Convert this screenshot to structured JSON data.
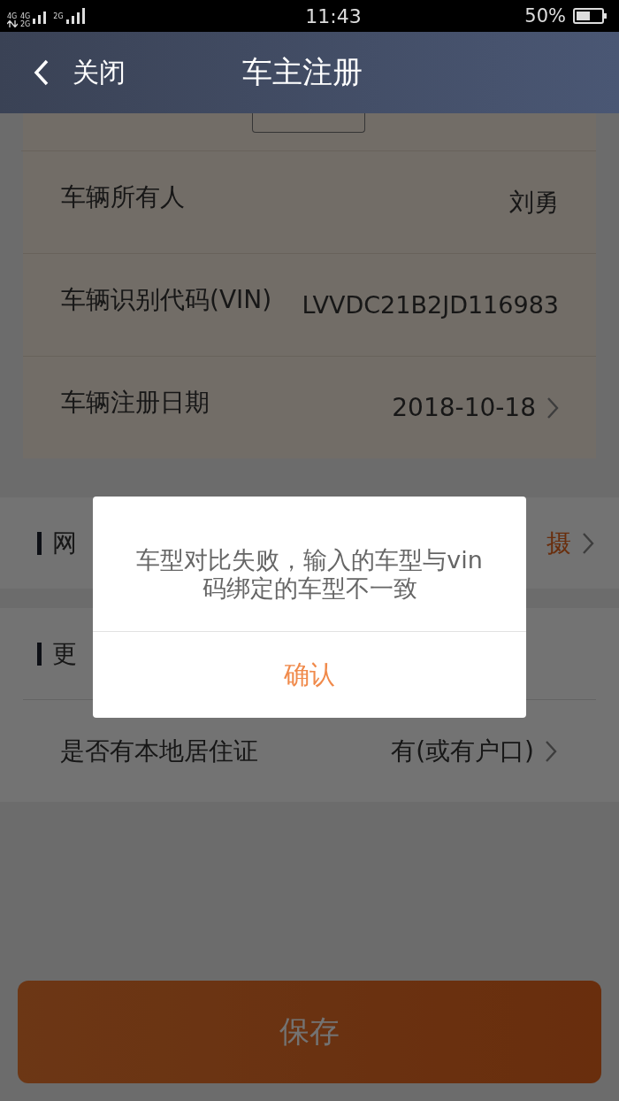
{
  "status_bar": {
    "network_labels": [
      "4G",
      "4G",
      "2G",
      "2G"
    ],
    "time": "11:43",
    "battery": "50%"
  },
  "nav": {
    "back_label": "关闭",
    "title": "车主注册"
  },
  "vehicle_rows": [
    {
      "label": "车辆所有人",
      "value": "刘勇",
      "chevron": false
    },
    {
      "label": "车辆识别代码(VIN)",
      "value": "LVVDC21B2JD116983",
      "chevron": false
    },
    {
      "label": "车辆注册日期",
      "value": "2018-10-18",
      "chevron": true
    }
  ],
  "photo_section": {
    "title": "网",
    "value": "摄",
    "chevron": true
  },
  "more_section": {
    "title": "更",
    "rows": [
      {
        "label": "是否有本地居住证",
        "value": "有(或有户口)",
        "chevron": true
      }
    ]
  },
  "dialog": {
    "message": "车型对比失败，输入的车型与vin码绑定的车型不一致",
    "confirm": "确认"
  },
  "save_button": "保存"
}
